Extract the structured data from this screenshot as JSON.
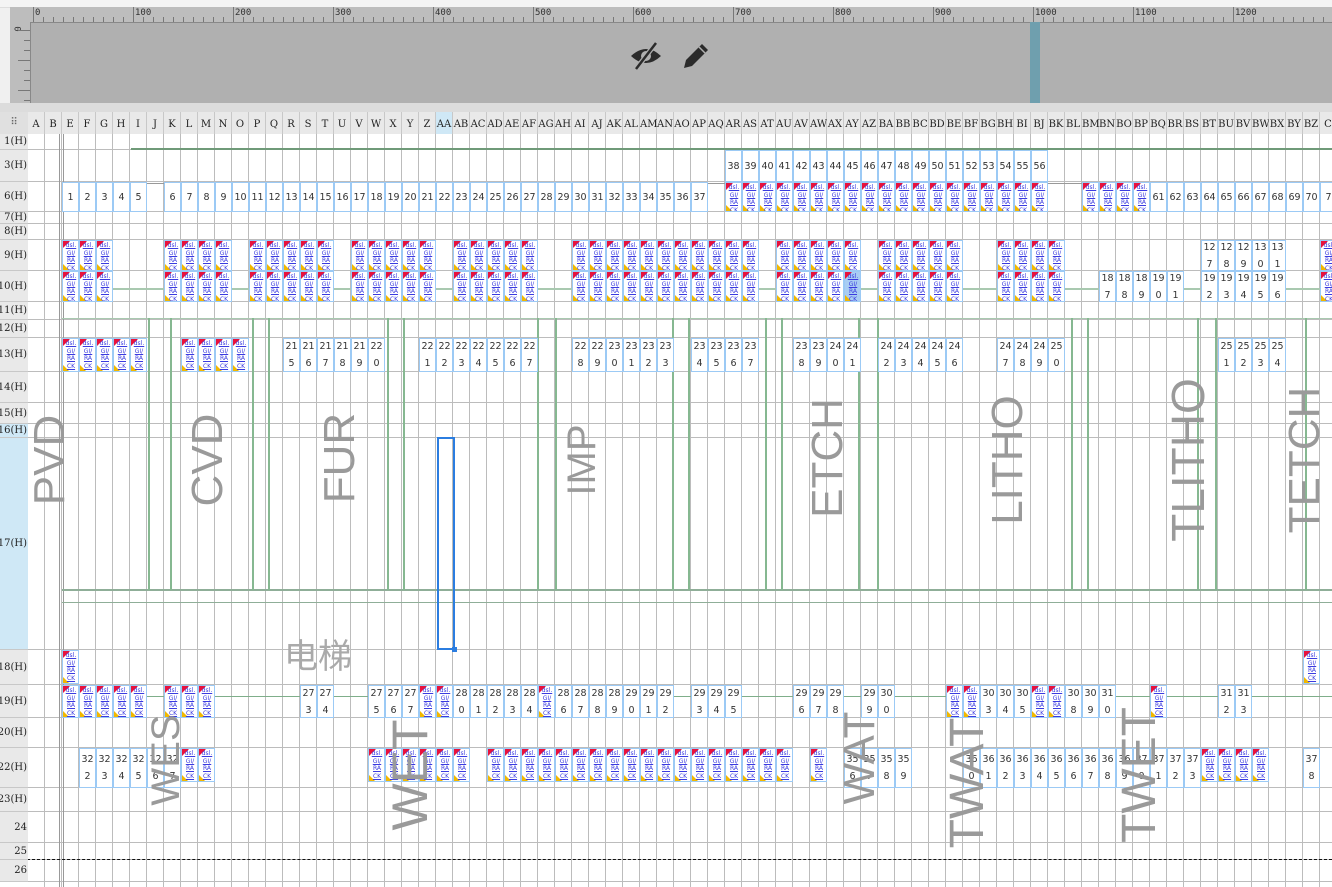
{
  "ruler": {
    "labels": [
      "0",
      "100",
      "200",
      "300",
      "400",
      "500",
      "600",
      "700",
      "800",
      "900",
      "1000",
      "1100",
      "1200"
    ],
    "vertical_label": "0"
  },
  "canvas_icons": [
    "eye-slash-icon",
    "pencil-icon"
  ],
  "sheet": {
    "corner_icon": "select-all-icon",
    "columns": [
      "A",
      "B",
      "E",
      "F",
      "G",
      "H",
      "I",
      "J",
      "K",
      "L",
      "M",
      "N",
      "O",
      "P",
      "Q",
      "R",
      "S",
      "T",
      "U",
      "V",
      "W",
      "X",
      "Y",
      "Z",
      "AA",
      "AB",
      "AC",
      "AD",
      "AE",
      "AF",
      "AG",
      "AH",
      "AI",
      "AJ",
      "AK",
      "AL",
      "AM",
      "AN",
      "AO",
      "AP",
      "AQ",
      "AR",
      "AS",
      "AT",
      "AU",
      "AV",
      "AW",
      "AX",
      "AY",
      "AZ",
      "BA",
      "BB",
      "BC",
      "BD",
      "BE",
      "BF",
      "BG",
      "BH",
      "BI",
      "BJ",
      "BK",
      "BL",
      "BM",
      "BN",
      "BO",
      "BP",
      "BQ",
      "BR",
      "BS",
      "BT",
      "BU",
      "BV",
      "BW",
      "BX",
      "BY",
      "BZ",
      "C"
    ],
    "selected_column": "AA",
    "rows": [
      "1(H)",
      "3(H)",
      "6(H)",
      "7(H)",
      "8(H)",
      "9(H)",
      "10(H)",
      "11(H)",
      "12(H)",
      "13(H)",
      "14(H)",
      "15(H)",
      "16(H)",
      "17(H)",
      "18(H)",
      "19(H)",
      "20(H)",
      "22(H)",
      "23(H)",
      "24",
      "25",
      "26"
    ],
    "selected_rows": [
      "16(H)",
      "17(H)"
    ],
    "widget_label": "dsl.GI/RACK",
    "highlighted_widget": {
      "row": "10(H)",
      "col": "AY"
    },
    "numbers": [
      {
        "row": "3(H)",
        "start": "AR",
        "values": [
          "38",
          "39",
          "40",
          "41",
          "42",
          "43",
          "44",
          "45",
          "46",
          "47",
          "48",
          "49",
          "50",
          "51",
          "52",
          "53",
          "54",
          "55",
          "56"
        ]
      },
      {
        "row": "6(H)",
        "start": "E",
        "values": [
          "1",
          "2",
          "3",
          "4",
          "5"
        ]
      },
      {
        "row": "6(H)",
        "start": "K",
        "values": [
          "6",
          "7",
          "8",
          "9",
          "10",
          "11",
          "12",
          "13",
          "14",
          "15",
          "16",
          "17",
          "18",
          "19",
          "20",
          "21",
          "22",
          "23",
          "24",
          "25",
          "26",
          "27",
          "28",
          "29",
          "30",
          "31",
          "32",
          "33",
          "34",
          "35",
          "36",
          "37"
        ]
      },
      {
        "row": "6(H)",
        "start": "BQ",
        "values": [
          "61",
          "62",
          "63",
          "64",
          "65",
          "66",
          "67",
          "68",
          "69",
          "70",
          "7"
        ]
      },
      {
        "row": "9(H)",
        "start": "BT",
        "values": [
          "127",
          "128",
          "129",
          "130",
          "131"
        ]
      },
      {
        "row": "10(H)",
        "start": "BN",
        "values": [
          "187",
          "188",
          "189",
          "190",
          "191"
        ]
      },
      {
        "row": "10(H)",
        "start": "BT",
        "values": [
          "192",
          "193",
          "194",
          "195",
          "196"
        ]
      },
      {
        "row": "13(H)",
        "start": "R",
        "values": [
          "215",
          "216",
          "217",
          "218",
          "219",
          "220"
        ]
      },
      {
        "row": "13(H)",
        "start": "Z",
        "values": [
          "221",
          "222",
          "223",
          "224",
          "225",
          "226",
          "227"
        ]
      },
      {
        "row": "13(H)",
        "start": "AI",
        "values": [
          "228",
          "229",
          "230",
          "231",
          "232",
          "233"
        ]
      },
      {
        "row": "13(H)",
        "start": "AP",
        "values": [
          "234",
          "235",
          "236",
          "237"
        ]
      },
      {
        "row": "13(H)",
        "start": "AV",
        "values": [
          "238",
          "239",
          "240",
          "241"
        ]
      },
      {
        "row": "13(H)",
        "start": "BA",
        "values": [
          "242",
          "243",
          "244",
          "245",
          "246"
        ]
      },
      {
        "row": "13(H)",
        "start": "BH",
        "values": [
          "247",
          "248",
          "249",
          "250"
        ]
      },
      {
        "row": "13(H)",
        "start": "BU",
        "values": [
          "251",
          "252",
          "253",
          "254"
        ]
      },
      {
        "row": "19(H)",
        "start": "S",
        "values": [
          "273",
          "274"
        ]
      },
      {
        "row": "19(H)",
        "start": "W",
        "values": [
          "275",
          "276",
          "277"
        ]
      },
      {
        "row": "19(H)",
        "start": "AB",
        "values": [
          "280",
          "281",
          "282",
          "283",
          "284"
        ]
      },
      {
        "row": "19(H)",
        "start": "AH",
        "values": [
          "286",
          "287",
          "288",
          "289",
          "290",
          "291",
          "292"
        ]
      },
      {
        "row": "19(H)",
        "start": "AP",
        "values": [
          "293",
          "294",
          "295"
        ]
      },
      {
        "row": "19(H)",
        "start": "AV",
        "values": [
          "296",
          "297",
          "298"
        ]
      },
      {
        "row": "19(H)",
        "start": "AZ",
        "values": [
          "299",
          "300"
        ]
      },
      {
        "row": "19(H)",
        "start": "BG",
        "values": [
          "303",
          "304",
          "305"
        ]
      },
      {
        "row": "19(H)",
        "start": "BL",
        "values": [
          "308",
          "309",
          "310"
        ]
      },
      {
        "row": "19(H)",
        "start": "BU",
        "values": [
          "312",
          "313"
        ]
      },
      {
        "row": "22(H)",
        "start": "F",
        "values": [
          "322",
          "323",
          "324",
          "325",
          "326",
          "327"
        ]
      },
      {
        "row": "22(H)",
        "start": "AY",
        "values": [
          "356",
          "357",
          "358",
          "359"
        ]
      },
      {
        "row": "22(H)",
        "start": "BF",
        "values": [
          "360",
          "361",
          "362",
          "363",
          "364",
          "365",
          "366",
          "367",
          "368",
          "369",
          "370",
          "371",
          "372",
          "373"
        ]
      },
      {
        "row": "22(H)",
        "start": "BZ",
        "values": [
          "378"
        ]
      }
    ],
    "widgets": [
      {
        "row": "6(H)",
        "start": "AR",
        "count": 19
      },
      {
        "row": "6(H)",
        "start": "BM",
        "count": 4
      },
      {
        "row": "9(H)",
        "start": "E",
        "count": 3
      },
      {
        "row": "9(H)",
        "start": "K",
        "count": 4
      },
      {
        "row": "9(H)",
        "start": "P",
        "count": 5
      },
      {
        "row": "9(H)",
        "start": "V",
        "count": 5
      },
      {
        "row": "9(H)",
        "start": "AB",
        "count": 5
      },
      {
        "row": "9(H)",
        "start": "AI",
        "count": 11
      },
      {
        "row": "9(H)",
        "start": "AU",
        "count": 5
      },
      {
        "row": "9(H)",
        "start": "BA",
        "count": 5
      },
      {
        "row": "9(H)",
        "start": "BH",
        "count": 4
      },
      {
        "row": "9(H)",
        "start": "C",
        "count": 1
      },
      {
        "row": "10(H)",
        "start": "E",
        "count": 3
      },
      {
        "row": "10(H)",
        "start": "K",
        "count": 4
      },
      {
        "row": "10(H)",
        "start": "P",
        "count": 5
      },
      {
        "row": "10(H)",
        "start": "V",
        "count": 5
      },
      {
        "row": "10(H)",
        "start": "AB",
        "count": 5
      },
      {
        "row": "10(H)",
        "start": "AI",
        "count": 11
      },
      {
        "row": "10(H)",
        "start": "AU",
        "count": 5
      },
      {
        "row": "10(H)",
        "start": "BA",
        "count": 5
      },
      {
        "row": "10(H)",
        "start": "BH",
        "count": 4
      },
      {
        "row": "10(H)",
        "start": "C",
        "count": 1
      },
      {
        "row": "13(H)",
        "start": "E",
        "count": 5
      },
      {
        "row": "13(H)",
        "start": "L",
        "count": 4
      },
      {
        "row": "18(H)",
        "start": "E",
        "count": 1
      },
      {
        "row": "18(H)",
        "start": "BZ",
        "count": 1
      },
      {
        "row": "19(H)",
        "start": "E",
        "count": 5
      },
      {
        "row": "19(H)",
        "start": "K",
        "count": 3
      },
      {
        "row": "19(H)",
        "start": "Z",
        "count": 2
      },
      {
        "row": "19(H)",
        "start": "AG",
        "count": 1
      },
      {
        "row": "19(H)",
        "start": "BE",
        "count": 2
      },
      {
        "row": "19(H)",
        "start": "BJ",
        "count": 2
      },
      {
        "row": "19(H)",
        "start": "BQ",
        "count": 1
      },
      {
        "row": "22(H)",
        "start": "L",
        "count": 2
      },
      {
        "row": "22(H)",
        "start": "W",
        "count": 6
      },
      {
        "row": "22(H)",
        "start": "AD",
        "count": 18
      },
      {
        "row": "22(H)",
        "start": "AW",
        "count": 1
      },
      {
        "row": "22(H)",
        "start": "BT",
        "count": 4
      }
    ],
    "zones_top": [
      "PVD",
      "CVD",
      "FUR",
      "IMP",
      "ETCH",
      "LITHO",
      "TLITHO",
      "TETCH"
    ],
    "zones_bottom": [
      "WES",
      "WET",
      "WAT",
      "TWAT",
      "TWET"
    ],
    "elevator_label": "电梯"
  }
}
